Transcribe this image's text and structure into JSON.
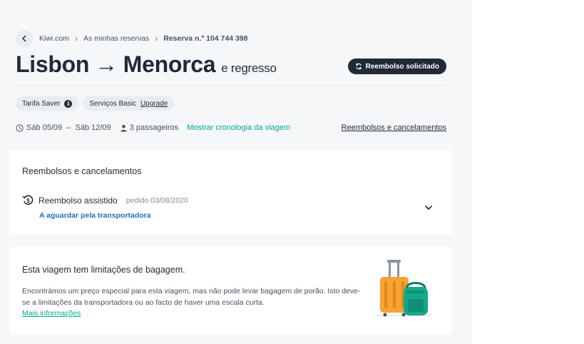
{
  "breadcrumb": {
    "items": [
      "Kiwi.com",
      "As minhas reservas",
      "Reserva n.º 104 744 398"
    ]
  },
  "header": {
    "origin": "Lisbon",
    "arrow": "→",
    "destination": "Menorca",
    "suffix": "e regresso",
    "status": "Reembolso solicitado"
  },
  "tags": {
    "fare": "Tarifa Saver",
    "services": "Serviços Basic",
    "upgrade": "Upgrade"
  },
  "meta": {
    "dates": "Sáb 05/09  –  Sáb 12/09",
    "passengers": "3 passageiros",
    "timeline": "Mostrar cronologia da viagem",
    "refunds_link": "Reembolsos e cancelamentos"
  },
  "refunds_card": {
    "title": "Reembolsos e cancelamentos",
    "refund_name": "Reembolso assistido",
    "refund_date": "pedido 03/08/2020",
    "refund_status": "A aguardar pela transportadora"
  },
  "baggage_card": {
    "title": "Esta viagem tem limitações de bagagem.",
    "text": "Encontrámos um preço especial para esta viagem, mas não pode levar bagagem de porão. Isto deve-se a limitações da transportadora ou ao facto de haver uma escala curta.",
    "more": "Mais informações"
  },
  "colors": {
    "accent_teal": "#00a991",
    "link_blue": "#1e73be",
    "dark": "#1f2a36",
    "background": "#f5f7f9"
  }
}
